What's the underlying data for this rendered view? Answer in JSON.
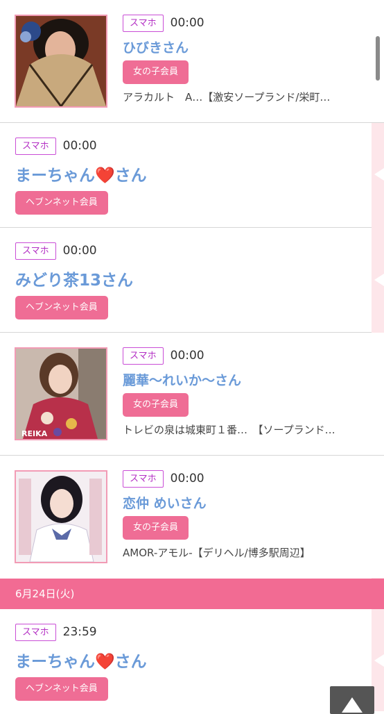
{
  "entries": [
    {
      "badge": "スマホ",
      "time": "00:00",
      "name": "ひびきさん",
      "member": "女の子会員",
      "shop": "アラカルト　A…【激安ソープランド/栄町…"
    },
    {
      "badge": "スマホ",
      "time": "00:00",
      "name": "まーちゃん❤️さん",
      "member": "ヘブンネット会員"
    },
    {
      "badge": "スマホ",
      "time": "00:00",
      "name": "みどり茶13さん",
      "member": "ヘブンネット会員"
    },
    {
      "badge": "スマホ",
      "time": "00:00",
      "name": "麗華〜れいか〜さん",
      "member": "女の子会員",
      "shop": "トレビの泉は城東町１番…　【ソープランド…",
      "thumb_caption": "REIKA"
    },
    {
      "badge": "スマホ",
      "time": "00:00",
      "name": "恋仲 めいさん",
      "member": "女の子会員",
      "shop": "AMOR-アモル-【デリヘル/博多駅周辺】"
    },
    {
      "badge": "スマホ",
      "time": "23:59",
      "name": "まーちゃん❤️さん",
      "member": "ヘブンネット会員"
    }
  ],
  "date_header": "6月24日(火)",
  "colors": {
    "accent": "#f26b93",
    "name": "#6a9ad8",
    "badge": "#c94dd6"
  },
  "icons": {
    "page_top": "up-arrow-icon"
  }
}
